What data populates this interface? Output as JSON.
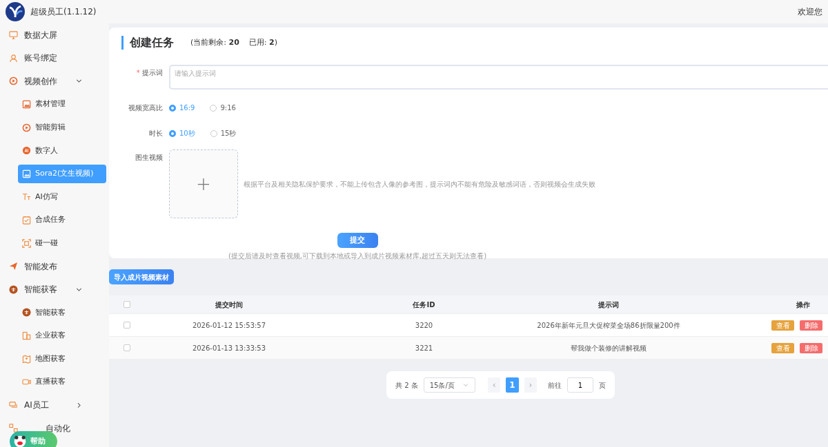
{
  "app": {
    "title": "超级员工(1.1.12)",
    "welcome": "欢迎您"
  },
  "sidebar": {
    "items": [
      {
        "label": "数据大屏",
        "kind": "top",
        "selected": false
      },
      {
        "label": "账号绑定",
        "kind": "top",
        "selected": false
      },
      {
        "label": "视频创作",
        "kind": "group",
        "expanded": true,
        "selected": false,
        "children": [
          {
            "label": "素材管理",
            "selected": false
          },
          {
            "label": "智能剪辑",
            "selected": false
          },
          {
            "label": "数字人",
            "selected": false
          },
          {
            "label": "Sora2(文生视频)",
            "selected": true
          },
          {
            "label": "AI仿写",
            "selected": false
          },
          {
            "label": "合成任务",
            "selected": false
          },
          {
            "label": "碰一碰",
            "selected": false
          }
        ]
      },
      {
        "label": "智能发布",
        "kind": "top",
        "selected": false
      },
      {
        "label": "智能获客",
        "kind": "group",
        "expanded": true,
        "selected": false,
        "children": [
          {
            "label": "智能获客",
            "selected": false
          },
          {
            "label": "企业获客",
            "selected": false
          },
          {
            "label": "地图获客",
            "selected": false
          },
          {
            "label": "直播获客",
            "selected": false
          }
        ]
      },
      {
        "label": "AI员工",
        "kind": "group",
        "expanded": false,
        "selected": false
      },
      {
        "label": "自动化",
        "kind": "top",
        "selected": false
      }
    ],
    "help_button": "帮助"
  },
  "form": {
    "title": "创建任务",
    "quota_label": "(当前剩余:",
    "quota_remaining": "20",
    "used_label": "已用:",
    "used": "2",
    "quota_end": ")",
    "prompt": {
      "label": "提示词",
      "required": true,
      "required_mark": "*",
      "placeholder": "请输入提示词"
    },
    "aspect": {
      "label": "视频宽高比",
      "options": [
        {
          "label": "16:9",
          "selected": true
        },
        {
          "label": "9:16",
          "selected": false
        }
      ]
    },
    "duration": {
      "label": "时长",
      "options": [
        {
          "label": "10秒",
          "selected": true
        },
        {
          "label": "15秒",
          "selected": false
        }
      ]
    },
    "image": {
      "label": "图生视频",
      "upload_icon": "+",
      "hint": "根据平台及相关隐私保护要求，不能上传包含人像的参考图，提示词内不能有危险及敏感词语，否则视频会生成失败"
    },
    "submit": "提交",
    "submit_note": "(提交后请及时查看视频,可下载到本地或导入到成片视频素材库,超过五天则无法查看)"
  },
  "import_button": "导入成片视频素材",
  "table": {
    "header_checked": false,
    "columns": [
      "提交时间",
      "任务ID",
      "提示词",
      "操作"
    ],
    "rows": [
      {
        "checked": false,
        "time": "2026-01-12 15:53:57",
        "id": "3220",
        "prompt": "2026年新年元旦大促榨菜全场86折限量200件",
        "actions": [
          "查看",
          "删除"
        ]
      },
      {
        "checked": false,
        "time": "2026-01-13 13:33:53",
        "id": "3221",
        "prompt": "帮我做个装修的讲解视频",
        "actions": [
          "查看",
          "删除"
        ]
      }
    ]
  },
  "pagination": {
    "total": "共 2 条",
    "page_size": "15条/页",
    "prev": "‹",
    "pages": [
      {
        "label": "1",
        "selected": true
      }
    ],
    "next": "›",
    "goto_label": "前往",
    "goto_value": "1",
    "goto_unit": "页"
  }
}
